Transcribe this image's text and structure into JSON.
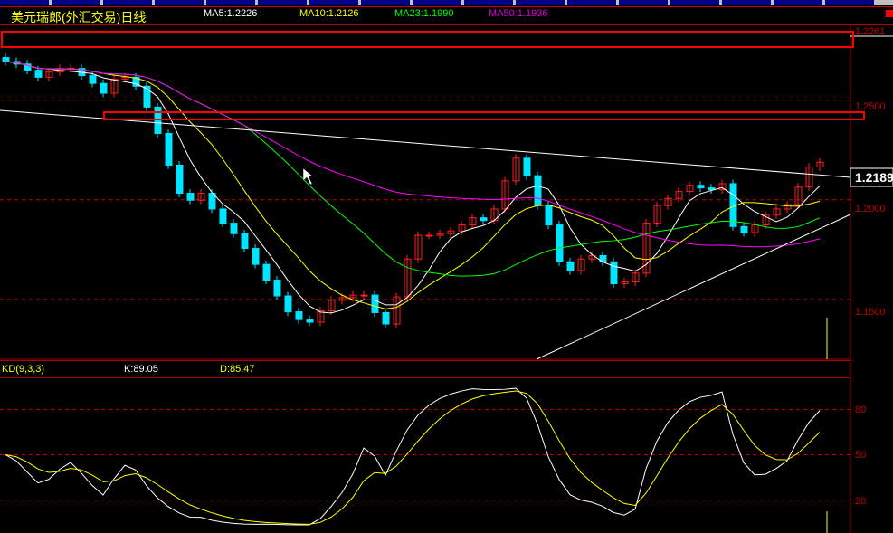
{
  "header": {
    "title": "美元瑞郎(外汇交易)日线",
    "ma5": "MA5:1.2226",
    "ma10": "MA10:1.2126",
    "ma23": "MA23:1.1990",
    "ma50": "MA50:1.1936"
  },
  "axis": {
    "labels": [
      "1.2261",
      "1.2500",
      "1.2000",
      "1.1500"
    ],
    "last_price": "1.2189"
  },
  "kd": {
    "title": "KD(9,3,3)",
    "k": "K:89.05",
    "d": "D:85.47",
    "ticks": [
      "80",
      "50",
      "20"
    ]
  },
  "colors": {
    "up": "#ff2020",
    "down": "#00e5ff",
    "ma5": "#ffffff",
    "ma10": "#ffff00",
    "ma23": "#00ff00",
    "ma50": "#ff00ff",
    "grid": "#c00000"
  },
  "chart_data": {
    "type": "candlestick",
    "ylim": [
      1.12,
      1.288
    ],
    "yticks": [
      1.25,
      1.2,
      1.15
    ],
    "closes": [
      1.2694,
      1.2681,
      1.265,
      1.2615,
      1.2641,
      1.2659,
      1.2659,
      1.2623,
      1.2584,
      1.2535,
      1.2606,
      1.2615,
      1.257,
      1.2465,
      1.2333,
      1.2174,
      1.2033,
      1.1998,
      1.2033,
      1.1954,
      1.1883,
      1.183,
      1.1756,
      1.1676,
      1.1597,
      1.1518,
      1.1438,
      1.1399,
      1.1386,
      1.1443,
      1.1496,
      1.1509,
      1.1522,
      1.1522,
      1.1434,
      1.1377,
      1.1513,
      1.1703,
      1.1822,
      1.1822,
      1.183,
      1.1844,
      1.1874,
      1.191,
      1.1896,
      1.1954,
      1.2095,
      1.2209,
      1.2121,
      1.1971,
      1.1874,
      1.1689,
      1.1645,
      1.1703,
      1.172,
      1.1689,
      1.1579,
      1.1588,
      1.1632,
      1.1883,
      1.1971,
      1.2007,
      1.2042,
      1.2073,
      1.206,
      1.2051,
      1.2081,
      1.1866,
      1.1835,
      1.1874,
      1.1923,
      1.1954,
      1.1976,
      1.2064,
      1.2165,
      1.2189
    ],
    "ma_periods": [
      5,
      10,
      23,
      50
    ],
    "kd_ticks": [
      80,
      50,
      20
    ],
    "kd_ylim": [
      0,
      100
    ]
  }
}
